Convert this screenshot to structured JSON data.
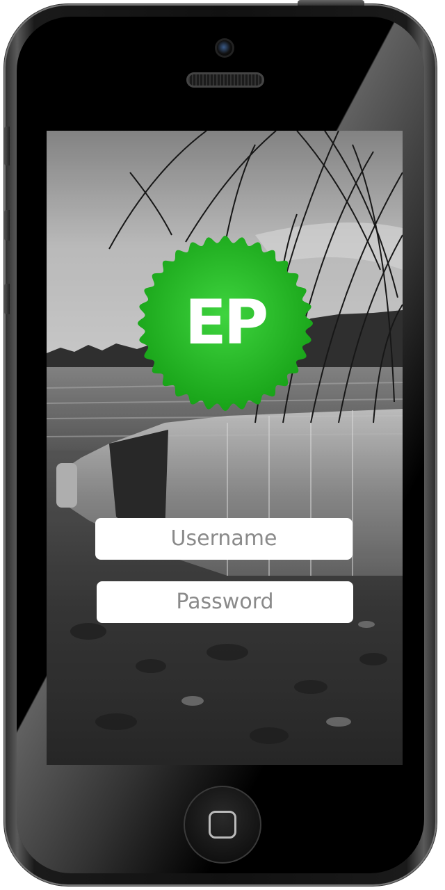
{
  "app": {
    "logo_text": "EP",
    "brand_color": "#22b322",
    "brand_color_light": "#3fd43f"
  },
  "login": {
    "username_placeholder": "Username",
    "password_placeholder": "Password"
  },
  "background": {
    "style": "grayscale photo",
    "subject": "bottle-in-lake"
  },
  "device": {
    "model": "phone",
    "color": "#000000"
  }
}
